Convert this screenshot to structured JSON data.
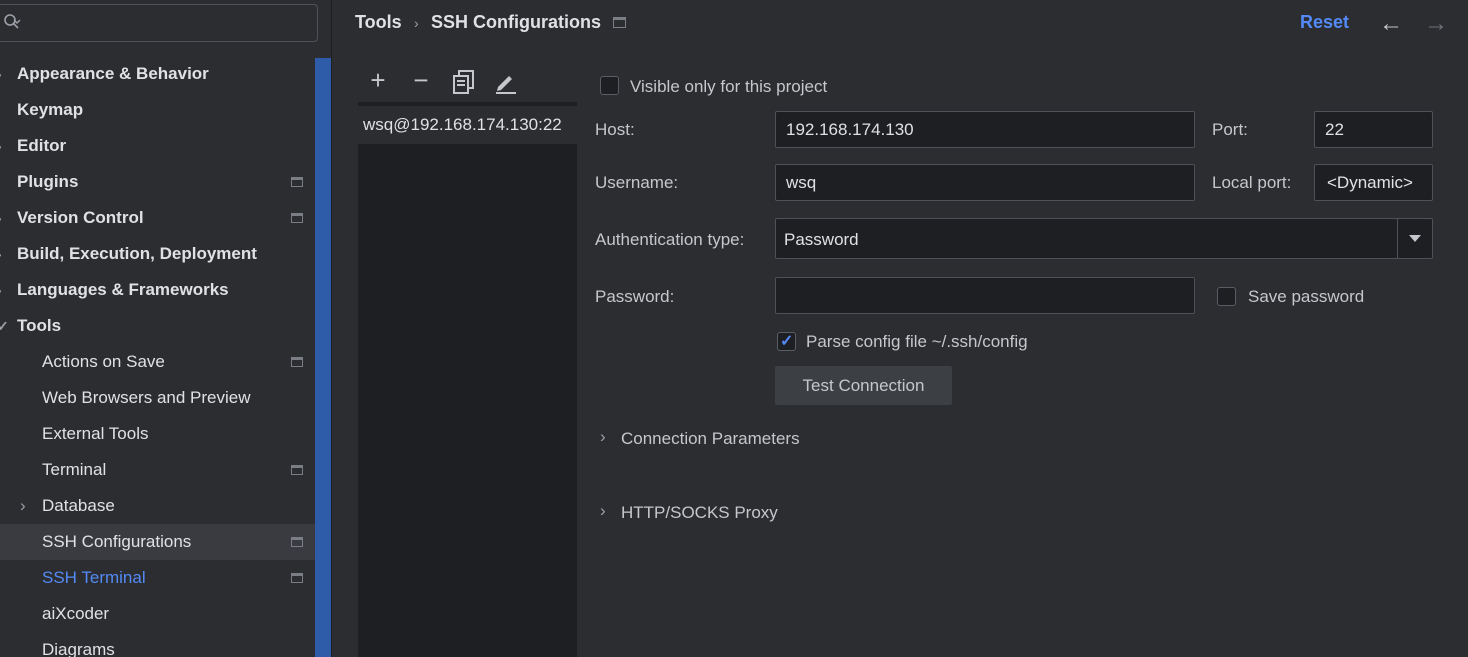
{
  "sidebar": {
    "items": [
      {
        "label": "Appearance & Behavior",
        "arrow": "›",
        "bold": true
      },
      {
        "label": "Keymap",
        "bold": true
      },
      {
        "label": "Editor",
        "arrow": "›",
        "bold": true
      },
      {
        "label": "Plugins",
        "bold": true,
        "project_icon": true
      },
      {
        "label": "Version Control",
        "arrow": "›",
        "bold": true,
        "project_icon": true
      },
      {
        "label": "Build, Execution, Deployment",
        "arrow": "›",
        "bold": true
      },
      {
        "label": "Languages & Frameworks",
        "arrow": "›",
        "bold": true
      },
      {
        "label": "Tools",
        "arrow": "✓",
        "bold": true
      },
      {
        "label": "Actions on Save",
        "child": true,
        "project_icon": true
      },
      {
        "label": "Web Browsers and Preview",
        "child": true
      },
      {
        "label": "External Tools",
        "child": true
      },
      {
        "label": "Terminal",
        "child": true,
        "project_icon": true
      },
      {
        "label": "Database",
        "child": true,
        "expand": "›"
      },
      {
        "label": "SSH Configurations",
        "child": true,
        "selected": true,
        "project_icon": true
      },
      {
        "label": "SSH Terminal",
        "child": true,
        "link": true,
        "project_icon": true
      },
      {
        "label": "aiXcoder",
        "child": true
      },
      {
        "label": "Diagrams",
        "child": true
      }
    ]
  },
  "header": {
    "crumb_parent": "Tools",
    "crumb_sep": "›",
    "crumb_current": "SSH Configurations",
    "reset_label": "Reset",
    "back_arrow": "←",
    "forward_arrow": "→"
  },
  "list": {
    "toolbar": {
      "add": "+",
      "remove": "−"
    },
    "items": [
      "wsq@192.168.174.130:22"
    ]
  },
  "form": {
    "visible_only_label": "Visible only for this project",
    "host_label": "Host:",
    "host_value": "192.168.174.130",
    "port_label": "Port:",
    "port_value": "22",
    "username_label": "Username:",
    "username_value": "wsq",
    "local_port_label": "Local port:",
    "local_port_value": "<Dynamic>",
    "auth_label": "Authentication type:",
    "auth_value": "Password",
    "password_label": "Password:",
    "password_value": "",
    "save_password_label": "Save password",
    "parse_config_label": "Parse config file ~/.ssh/config",
    "test_connection_label": "Test Connection",
    "connection_params_label": "Connection Parameters",
    "proxy_label": "HTTP/SOCKS Proxy"
  },
  "colors": {
    "accent": "#548af7",
    "scrollbar": "#2e5ca8"
  }
}
